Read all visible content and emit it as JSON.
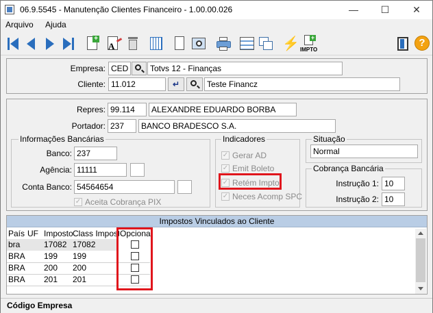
{
  "window": {
    "title": "06.9.5545 - Manutenção Clientes Financeiro - 1.00.00.026",
    "min": "—",
    "max": "☐",
    "close": "✕"
  },
  "menu": {
    "arquivo": "Arquivo",
    "ajuda": "Ajuda"
  },
  "toolbar": {
    "impto_label": "IMPTO",
    "help": "?"
  },
  "header": {
    "empresa_label": "Empresa:",
    "empresa_code": "CED",
    "empresa_name": "Totvs 12 - Finanças",
    "cliente_label": "Cliente:",
    "cliente_code": "11.012",
    "cliente_name": "Teste Financz"
  },
  "details": {
    "repres_label": "Repres:",
    "repres_code": "99.114",
    "repres_name": "ALEXANDRE EDUARDO BORBA",
    "portador_label": "Portador:",
    "portador_code": "237",
    "portador_name": "BANCO BRADESCO S.A."
  },
  "bank": {
    "title": "Informações Bancárias",
    "banco_label": "Banco:",
    "banco": "237",
    "agencia_label": "Agência:",
    "agencia": "11111",
    "conta_label": "Conta Banco:",
    "conta": "54564654",
    "pix_label": "Aceita Cobrança PIX"
  },
  "indicadores": {
    "title": "Indicadores",
    "items": [
      "Gerar AD",
      "Emit Boleto",
      "Retém Impto",
      "Neces Acomp SPC"
    ]
  },
  "situacao": {
    "title": "Situação",
    "value": "Normal"
  },
  "cobranca": {
    "title": "Cobrança Bancária",
    "instr1_label": "Instrução 1:",
    "instr1": "10",
    "instr2_label": "Instrução 2:",
    "instr2": "10"
  },
  "grid": {
    "title": "Impostos Vinculados ao Cliente",
    "columns": [
      "País",
      "UF",
      "Imposto",
      "Class Imposto",
      "Opcional"
    ],
    "rows": [
      {
        "pais": "bra",
        "uf": "",
        "imposto": "17082",
        "class": "17082"
      },
      {
        "pais": "BRA",
        "uf": "",
        "imposto": "199",
        "class": "199"
      },
      {
        "pais": "BRA",
        "uf": "",
        "imposto": "200",
        "class": "200"
      },
      {
        "pais": "BRA",
        "uf": "",
        "imposto": "201",
        "class": "201"
      }
    ]
  },
  "status": {
    "text": "Código Empresa"
  }
}
